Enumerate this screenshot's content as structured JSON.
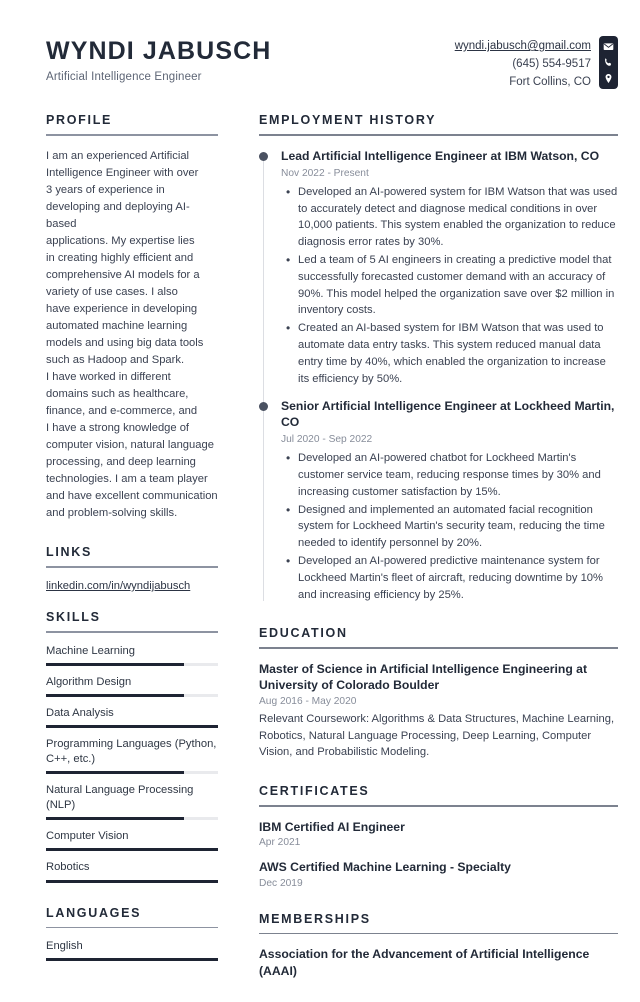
{
  "header": {
    "name": "WYNDI JABUSCH",
    "title": "Artificial Intelligence Engineer",
    "contact": {
      "email": "wyndi.jabusch@gmail.com",
      "phone": "(645) 554-9517",
      "location": "Fort Collins, CO",
      "email_icon": "envelope-icon",
      "phone_icon": "phone-icon",
      "location_icon": "map-pin-icon"
    }
  },
  "left": {
    "profile": {
      "heading": "PROFILE",
      "text": "I am an experienced Artificial\nIntelligence Engineer with over\n3 years of experience in\ndeveloping and deploying AI-based\napplications. My expertise lies\nin creating highly efficient and\ncomprehensive AI models for a\nvariety of use cases. I also\nhave experience in developing\nautomated machine learning\nmodels and using big data tools\nsuch as Hadoop and Spark.\nI have worked in different\ndomains such as healthcare,\nfinance, and e-commerce, and\nI have a strong knowledge of\ncomputer vision, natural language\nprocessing, and deep learning\ntechnologies. I am a team player\nand have excellent communication\nand problem-solving skills."
    },
    "links": {
      "heading": "LINKS",
      "items": [
        {
          "label": "linkedin.com/in/wyndijabusch"
        }
      ]
    },
    "skills": {
      "heading": "SKILLS",
      "items": [
        {
          "label": "Machine Learning",
          "level": 80
        },
        {
          "label": "Algorithm Design",
          "level": 80
        },
        {
          "label": "Data Analysis",
          "level": 100
        },
        {
          "label": "Programming Languages (Python, C++, etc.)",
          "level": 80
        },
        {
          "label": "Natural Language Processing (NLP)",
          "level": 80
        },
        {
          "label": "Computer Vision",
          "level": 100
        },
        {
          "label": "Robotics",
          "level": 100
        }
      ]
    },
    "languages": {
      "heading": "LANGUAGES",
      "items": [
        {
          "label": "English",
          "level": 100
        }
      ]
    }
  },
  "right": {
    "employment": {
      "heading": "EMPLOYMENT HISTORY",
      "jobs": [
        {
          "title": "Lead Artificial Intelligence Engineer at IBM Watson, CO",
          "dates": "Nov 2022 - Present",
          "bullets": [
            "Developed an AI-powered system for IBM Watson that was used to accurately detect and diagnose medical conditions in over 10,000 patients. This system enabled the organization to reduce diagnosis error rates by 30%.",
            "Led a team of 5 AI engineers in creating a predictive model that successfully forecasted customer demand with an accuracy of 90%. This model helped the organization save over $2 million in inventory costs.",
            "Created an AI-based system for IBM Watson that was used to automate data entry tasks. This system reduced manual data entry time by 40%, which enabled the organization to increase its efficiency by 50%."
          ]
        },
        {
          "title": "Senior Artificial Intelligence Engineer at Lockheed Martin, CO",
          "dates": "Jul 2020 - Sep 2022",
          "bullets": [
            "Developed an AI-powered chatbot for Lockheed Martin's customer service team, reducing response times by 30% and increasing customer satisfaction by 15%.",
            "Designed and implemented an automated facial recognition system for Lockheed Martin's security team, reducing the time needed to identify personnel by 20%.",
            "Developed an AI-powered predictive maintenance system for Lockheed Martin's fleet of aircraft, reducing downtime by 10% and increasing efficiency by 25%."
          ]
        }
      ]
    },
    "education": {
      "heading": "EDUCATION",
      "entries": [
        {
          "title": "Master of Science in Artificial Intelligence Engineering at University of Colorado Boulder",
          "dates": "Aug 2016 - May 2020",
          "description": "Relevant Coursework: Algorithms & Data Structures, Machine Learning, Robotics, Natural Language Processing, Deep Learning, Computer Vision, and Probabilistic Modeling."
        }
      ]
    },
    "certificates": {
      "heading": "CERTIFICATES",
      "entries": [
        {
          "title": "IBM Certified AI Engineer",
          "dates": "Apr 2021"
        },
        {
          "title": "AWS Certified Machine Learning - Specialty",
          "dates": "Dec 2019"
        }
      ]
    },
    "memberships": {
      "heading": "MEMBERSHIPS",
      "entries": [
        {
          "title": "Association for the Advancement of Artificial Intelligence (AAAI)"
        }
      ]
    }
  },
  "colors": {
    "ink": "#222a38",
    "body": "#3b4252",
    "muted": "#878d9a",
    "rule": "#8d93a1",
    "accent_dark": "#1e2433",
    "track": "#e9eaed"
  }
}
